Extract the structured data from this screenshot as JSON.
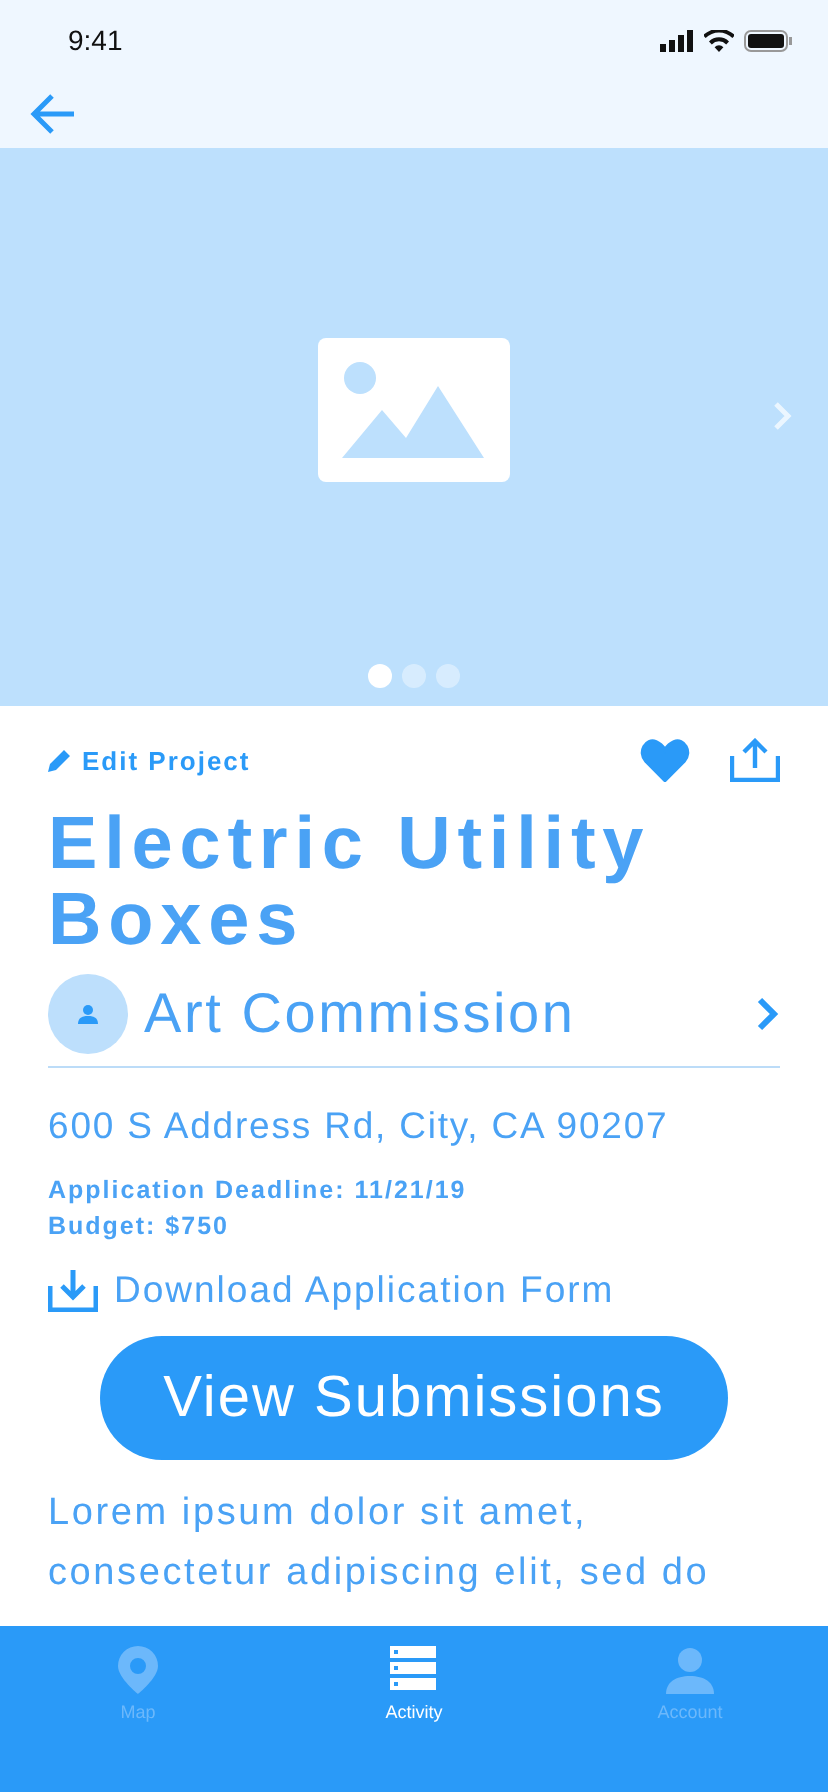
{
  "status_bar": {
    "time": "9:41"
  },
  "hero": {
    "dots": [
      {
        "selected": true
      },
      {
        "selected": false
      },
      {
        "selected": false
      }
    ]
  },
  "edit_link": "Edit Project",
  "favorite": {
    "on": true
  },
  "title": "Electric Utility Boxes",
  "organization": "Art Commission",
  "address": "600 S Address Rd, City, CA 90207",
  "details": [
    "Application Deadline: 11/21/19",
    "Budget: $750"
  ],
  "download_link": "Download Application Form",
  "primary_button": "View Submissions",
  "description": "Lorem ipsum dolor sit amet, consectetur adipiscing elit, sed do",
  "tab_bar": [
    {
      "label": "Map",
      "kind": "pin",
      "selected": false
    },
    {
      "label": "Activity",
      "kind": "list",
      "selected": true
    },
    {
      "label": "Account",
      "kind": "person",
      "selected": false
    }
  ]
}
